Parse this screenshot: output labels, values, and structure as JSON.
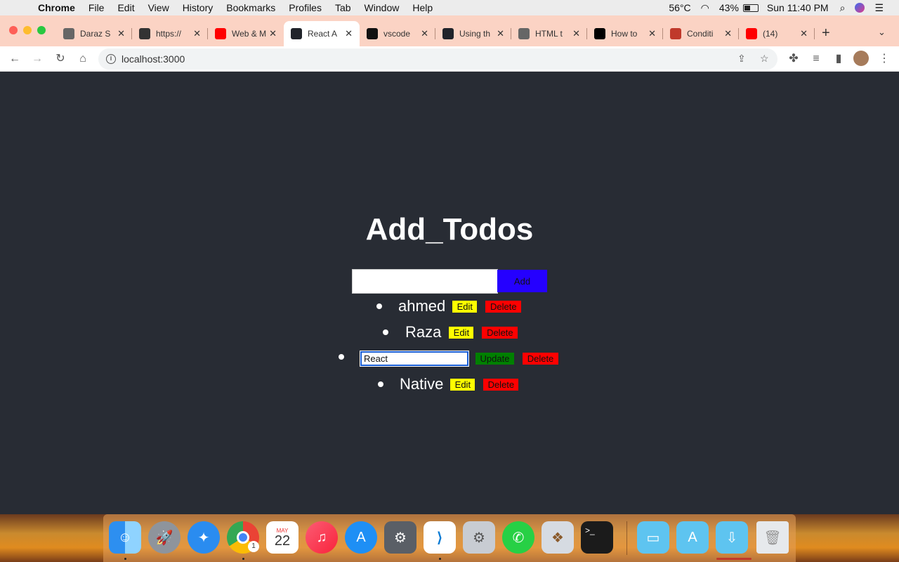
{
  "menubar": {
    "app_name": "Chrome",
    "items": [
      "File",
      "Edit",
      "View",
      "History",
      "Bookmarks",
      "Profiles",
      "Tab",
      "Window",
      "Help"
    ],
    "temperature": "56°C",
    "battery": "43%",
    "clock": "Sun 11:40 PM"
  },
  "tabs": [
    {
      "label": "Daraz S",
      "icon": "globe-icon",
      "color": "#666666"
    },
    {
      "label": "https://",
      "icon": "amazon-icon",
      "color": "#333333"
    },
    {
      "label": "Web & M",
      "icon": "youtube-icon",
      "color": "#ff0000"
    },
    {
      "label": "React A",
      "icon": "react-icon",
      "color": "#20232a"
    },
    {
      "label": "vscode",
      "icon": "github-icon",
      "color": "#111111"
    },
    {
      "label": "Using th",
      "icon": "react-icon",
      "color": "#20232a"
    },
    {
      "label": "HTML t",
      "icon": "globe-icon",
      "color": "#666666"
    },
    {
      "label": "How to",
      "icon": "medium-icon",
      "color": "#000000"
    },
    {
      "label": "Conditi",
      "icon": "tower-icon",
      "color": "#c0392b"
    },
    {
      "label": "(14)",
      "icon": "youtube-icon",
      "color": "#ff0000"
    }
  ],
  "active_tab_index": 3,
  "toolbar": {
    "url": "localhost:3000"
  },
  "app": {
    "heading": "Add_Todos",
    "add_input_value": "",
    "add_label": "Add",
    "edit_label": "Edit",
    "delete_label": "Delete",
    "update_label": "Update",
    "todos": [
      {
        "text": "ahmed",
        "editing": false
      },
      {
        "text": "Raza",
        "editing": false
      },
      {
        "text": "React",
        "editing": true
      },
      {
        "text": "Native",
        "editing": false
      }
    ]
  },
  "dock": {
    "chrome_badge": "1",
    "calendar_month": "MAY",
    "calendar_day": "22",
    "apps": [
      "finder",
      "launchpad",
      "safari",
      "chrome",
      "calendar",
      "music",
      "app-store",
      "system-preferences",
      "vscode",
      "utilities",
      "whatsapp",
      "preview",
      "terminal",
      "documents-folder",
      "applications-folder",
      "downloads-folder",
      "trash"
    ]
  },
  "colors": {
    "page_bg": "#282c34",
    "add_button": "#2500ff",
    "edit_button": "#ffff00",
    "delete_button": "#ff0000",
    "update_button": "#008000",
    "tabstrip": "#fbd3c4"
  }
}
